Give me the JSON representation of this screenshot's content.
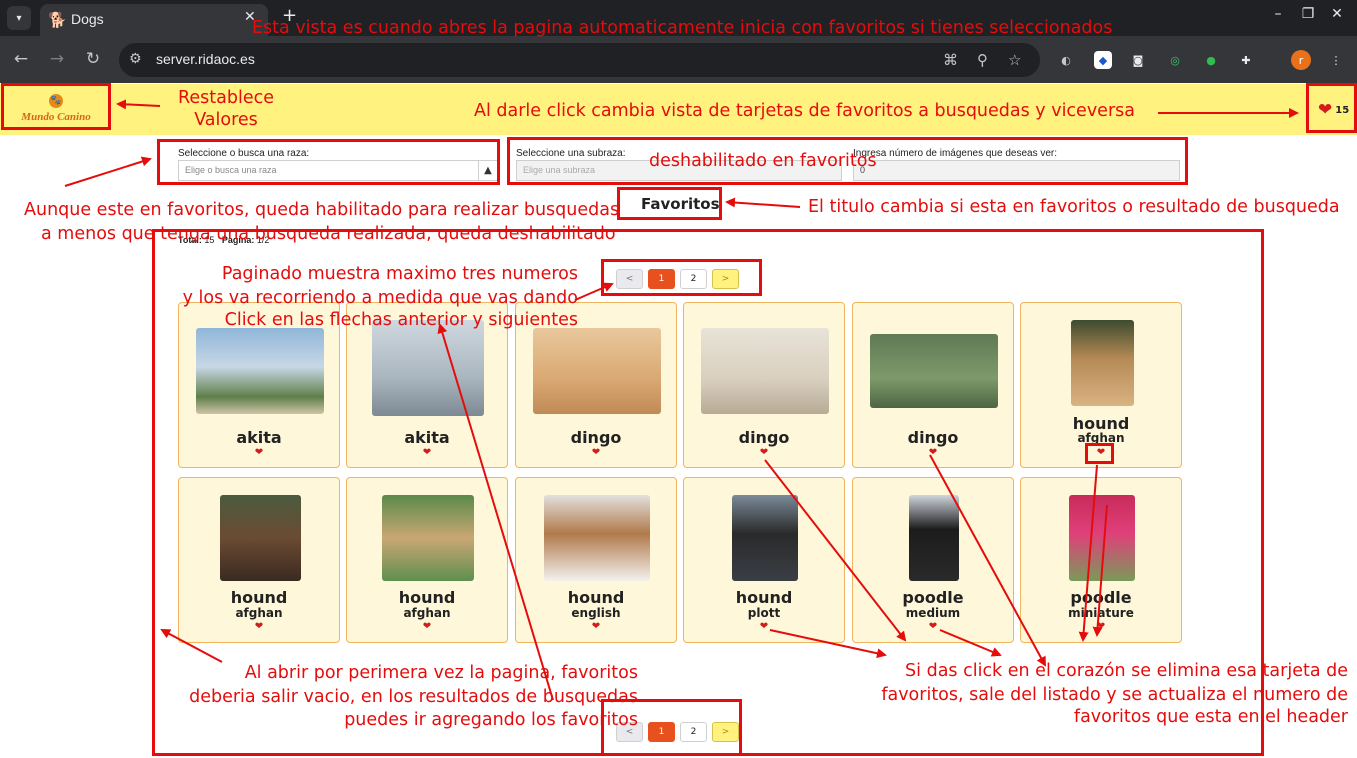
{
  "browser": {
    "tab_title": "Dogs",
    "url": "server.ridaoc.es",
    "profile_initial": "r"
  },
  "header": {
    "logo_text": "Mundo Canino",
    "favorites_count": "15"
  },
  "filters": {
    "breed_label": "Seleccione o busca una raza:",
    "breed_placeholder": "Elige o busca una raza",
    "subbreed_label": "Seleccione una subraza:",
    "subbreed_placeholder": "Elige una subraza",
    "count_label": "Ingresa número de imágenes que deseas ver:",
    "count_value": "0"
  },
  "main": {
    "title": "Favoritos",
    "total_label": "Total:",
    "total_value": "15",
    "page_label": "Pagina:",
    "page_value": "1/2"
  },
  "pagination": {
    "prev": "<",
    "pages": [
      "1",
      "2"
    ],
    "next": ">"
  },
  "cards": [
    {
      "breed": "akita",
      "sub": ""
    },
    {
      "breed": "akita",
      "sub": ""
    },
    {
      "breed": "dingo",
      "sub": ""
    },
    {
      "breed": "dingo",
      "sub": ""
    },
    {
      "breed": "dingo",
      "sub": ""
    },
    {
      "breed": "hound",
      "sub": "afghan"
    },
    {
      "breed": "hound",
      "sub": "afghan"
    },
    {
      "breed": "hound",
      "sub": "afghan"
    },
    {
      "breed": "hound",
      "sub": "english"
    },
    {
      "breed": "hound",
      "sub": "plott"
    },
    {
      "breed": "poodle",
      "sub": "medium"
    },
    {
      "breed": "poodle",
      "sub": "miniature"
    }
  ],
  "annotations": {
    "top": "Esta vista es cuando abres la pagina automaticamente inicia con favoritos si tienes seleccionados",
    "reset": "Restablece\nValores",
    "toggle": "Al darle click cambia vista de tarjetas de favoritos a busquedas y viceversa",
    "disabled": "deshabilitado en favoritos",
    "search_1": "Aunque este en favoritos, queda habilitado para realizar busquedas",
    "search_2": "a menos que tenga una busqueda realizada, queda deshabilitado",
    "title_change": "El titulo cambia si esta en favoritos o resultado de busqueda",
    "paging_1": "Paginado muestra maximo tres numeros",
    "paging_2": "y los va recorriendo a medida que vas dando",
    "paging_3": "Click en las flechas anterior y siguientes",
    "empty_1": "Al abrir por perimera vez la pagina, favoritos",
    "empty_2": "deberia salir vacio, en los resultados de busquedas",
    "empty_3": "puedes ir agregando los favoritos",
    "heart_1": "Si das click en el corazón se elimina esa tarjeta de",
    "heart_2": "favoritos, sale del listado y se actualiza el numero de",
    "heart_3": "favoritos que esta en el header"
  }
}
